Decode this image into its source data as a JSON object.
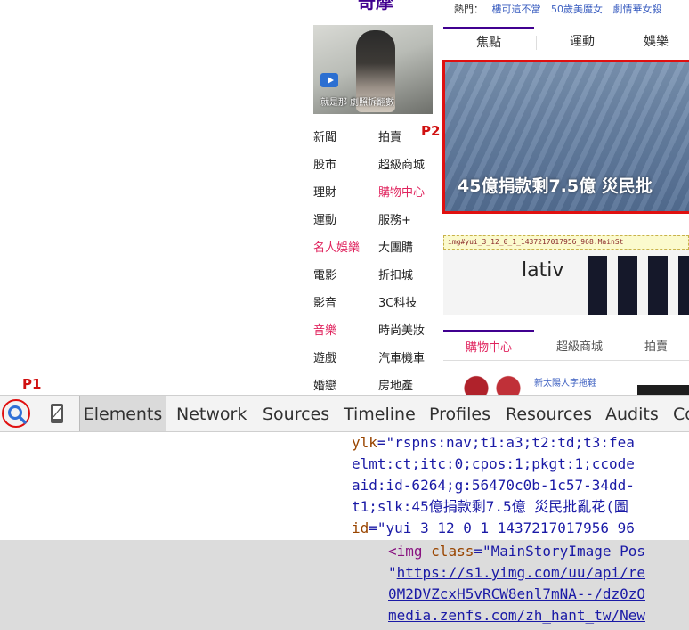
{
  "page": {
    "logo": "奇摩",
    "hot": {
      "label": "熱門：",
      "items": [
        "樓可這不當",
        "50歲美魔女",
        "劇情華女殺"
      ]
    },
    "thumb_caption": "就是那 劇照拆翻數",
    "nav_col1": [
      "新聞",
      "股市",
      "理財",
      "運動",
      "名人娛樂",
      "電影",
      "影音",
      "音樂",
      "遊戲",
      "婚戀"
    ],
    "nav_col2": [
      "拍賣",
      "超級商城",
      "購物中心",
      "服務+",
      "大團購",
      "折扣城",
      "3C科技",
      "時尚美妝",
      "汽車機車",
      "房地產"
    ],
    "tabs": [
      "焦點",
      "運動",
      "娛樂"
    ],
    "main_headline": "45億捐款剩7.5億 災民批",
    "tooltip": "img#yui_3_12_0_1_1437217017956_968.MainSt",
    "ad_brand": "lativ",
    "shop_tabs": [
      "購物中心",
      "超級商城",
      "拍賣"
    ],
    "shop_item": "新太陽人字拖鞋"
  },
  "annotations": {
    "p1": "P1",
    "p2": "P2"
  },
  "devtools": {
    "tabs": [
      "Elements",
      "Network",
      "Sources",
      "Timeline",
      "Profiles",
      "Resources",
      "Audits",
      "Co"
    ],
    "code": {
      "l1_attr": "ylk",
      "l1_val": "\"rspns:nav;t1:a3;t2:td;t3:fea",
      "l2": "elmt:ct;itc:0;cpos:1;pkgt:1;ccode",
      "l3": "aid:id-6264;g:56470c0b-1c57-34dd-",
      "l4": "t1;slk:45億捐款剩7.5億 災民批亂花(圖",
      "l5_attr": "id",
      "l5_val": "\"yui_3_12_0_1_1437217017956_96",
      "l6_tag": "<img",
      "l6_attr": "class",
      "l6_val": "\"MainStoryImage Pos",
      "l7_q": "\"",
      "l7_url": "https://s1.yimg.com/uu/api/re",
      "l8": "0M2DVZcxH5vRCW8enl7mNA--/dz0zO",
      "l9": "media.zenfs.com/zh_hant_tw/New"
    }
  },
  "colors": {
    "highlight_red": "#e01010",
    "brand_purple": "#400090",
    "link_pink": "#e0245e"
  }
}
